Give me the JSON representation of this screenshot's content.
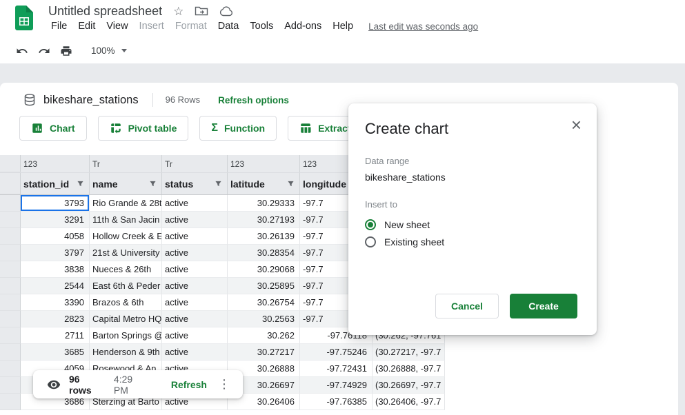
{
  "colors": {
    "green": "#188038",
    "logo_green": "#0f9d58",
    "selection_blue": "#1a73e8"
  },
  "titlebar": {
    "title": "Untitled spreadsheet",
    "menus": [
      {
        "label": "File",
        "disabled": false
      },
      {
        "label": "Edit",
        "disabled": false
      },
      {
        "label": "View",
        "disabled": false
      },
      {
        "label": "Insert",
        "disabled": true
      },
      {
        "label": "Format",
        "disabled": true
      },
      {
        "label": "Data",
        "disabled": false
      },
      {
        "label": "Tools",
        "disabled": false
      },
      {
        "label": "Add-ons",
        "disabled": false
      },
      {
        "label": "Help",
        "disabled": false
      }
    ],
    "last_edit": "Last edit was seconds ago"
  },
  "toolbar": {
    "zoom": "100%"
  },
  "sheet_header": {
    "name": "bikeshare_stations",
    "row_count": "96 Rows",
    "refresh_options": "Refresh options",
    "actions": [
      "Chart",
      "Pivot table",
      "Function",
      "Extract"
    ]
  },
  "table": {
    "columns": [
      {
        "type": "123",
        "name": "station_id"
      },
      {
        "type": "Tr",
        "name": "name"
      },
      {
        "type": "Tr",
        "name": "status"
      },
      {
        "type": "123",
        "name": "latitude"
      },
      {
        "type": "123",
        "name": "longitude"
      },
      {
        "type": "",
        "name": ""
      }
    ],
    "rows": [
      [
        "3793",
        "Rio Grande & 28t",
        "active",
        "30.29333",
        "-97.7",
        ""
      ],
      [
        "3291",
        "11th & San Jacin",
        "active",
        "30.27193",
        "-97.7",
        ""
      ],
      [
        "4058",
        "Hollow Creek & E",
        "active",
        "30.26139",
        "-97.7",
        ""
      ],
      [
        "3797",
        "21st & University",
        "active",
        "30.28354",
        "-97.7",
        ""
      ],
      [
        "3838",
        "Nueces & 26th",
        "active",
        "30.29068",
        "-97.7",
        ""
      ],
      [
        "2544",
        "East 6th & Peder",
        "active",
        "30.25895",
        "-97.7",
        ""
      ],
      [
        "3390",
        "Brazos & 6th",
        "active",
        "30.26754",
        "-97.7",
        ""
      ],
      [
        "2823",
        "Capital Metro HQ",
        "active",
        "30.2563",
        "-97.7",
        ""
      ],
      [
        "2711",
        "Barton Springs @",
        "active",
        "30.262",
        "-97.76118",
        "(30.262, -97.761"
      ],
      [
        "3685",
        "Henderson & 9th",
        "active",
        "30.27217",
        "-97.75246",
        "(30.27217, -97.7"
      ],
      [
        "4059",
        "Rosewood & An",
        "active",
        "30.26888",
        "-97.72431",
        "(30.26888, -97.7"
      ],
      [
        "",
        "",
        "",
        "30.26697",
        "-97.74929",
        "(30.26697, -97.7"
      ],
      [
        "3686",
        "Sterzing at Barto",
        "active",
        "30.26406",
        "-97.76385",
        "(30.26406, -97.7"
      ]
    ]
  },
  "dialog": {
    "title": "Create chart",
    "data_range_label": "Data range",
    "data_range_value": "bikeshare_stations",
    "insert_to_label": "Insert to",
    "options": [
      "New sheet",
      "Existing sheet"
    ],
    "selected_option": "New sheet",
    "cancel_label": "Cancel",
    "create_label": "Create"
  },
  "status_bar": {
    "row_count": "96 rows",
    "time": "4:29 PM",
    "refresh_label": "Refresh"
  }
}
